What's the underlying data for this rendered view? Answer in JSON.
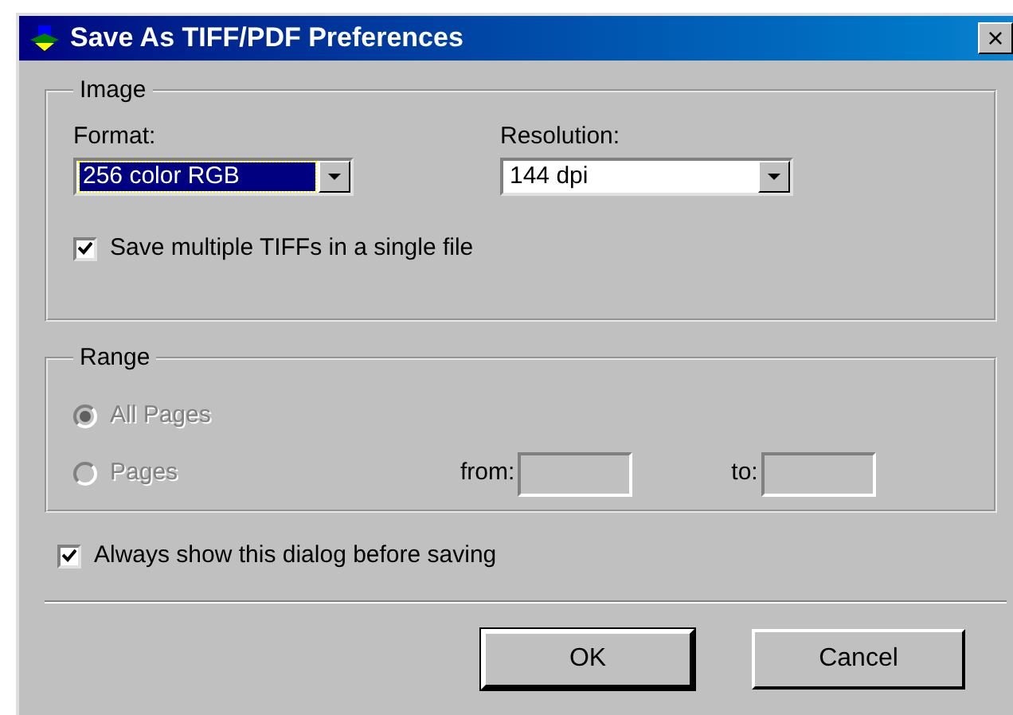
{
  "window": {
    "title": "Save As TIFF/PDF Preferences",
    "close": "×"
  },
  "image": {
    "legend": "Image",
    "format": {
      "label": "Format:",
      "value": "256 color RGB",
      "focused": true
    },
    "resolution": {
      "label": "Resolution:",
      "value": "144 dpi",
      "focused": false
    },
    "multi": {
      "label": "Save multiple TIFFs in a single file",
      "checked": true
    }
  },
  "range": {
    "legend": "Range",
    "disabled": true,
    "options": [
      {
        "label": "All Pages",
        "selected": true
      },
      {
        "label": "Pages",
        "selected": false
      }
    ],
    "from": {
      "label": "from:"
    },
    "to": {
      "label": "to:"
    }
  },
  "always": {
    "label": "Always show this dialog before saving",
    "checked": true
  },
  "buttons": [
    {
      "label": "OK",
      "default": true
    },
    {
      "label": "Cancel",
      "default": false
    }
  ]
}
